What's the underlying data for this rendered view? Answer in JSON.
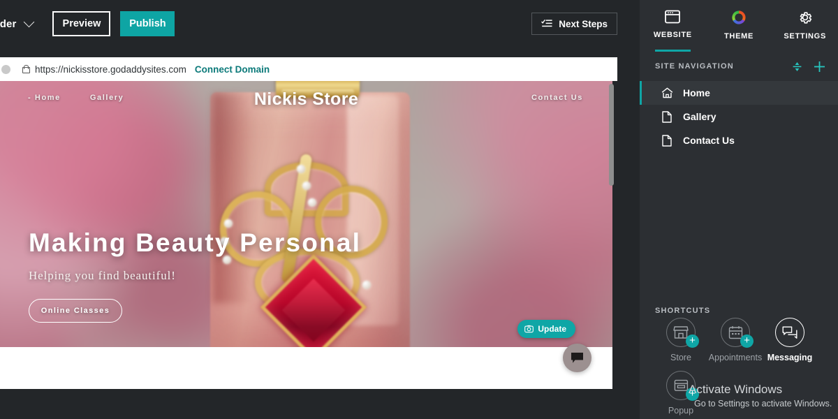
{
  "toolbar": {
    "brand_label": "uilder",
    "brand_chevron": "chevron-down-icon",
    "preview_label": "Preview",
    "publish_label": "Publish",
    "next_steps_label": "Next Steps",
    "next_steps_icon": "checklist-icon"
  },
  "browser": {
    "url": "https://nickisstore.godaddysites.com",
    "connect_domain_label": "Connect Domain",
    "lock_icon": "lock-icon"
  },
  "site": {
    "title": "Nickis Store",
    "nav": [
      {
        "label": "- Home"
      },
      {
        "label": "Gallery"
      },
      {
        "label": "Contact Us"
      }
    ],
    "hero_title": "Making Beauty Personal",
    "hero_subtitle": "Helping you find beautiful!",
    "hero_button": "Online Classes",
    "update_button": "Update",
    "update_icon": "image-icon",
    "chat_icon": "chat-bubble-icon"
  },
  "panel": {
    "tabs": [
      {
        "label": "WEBSITE",
        "icon": "browser-window-icon",
        "active": true
      },
      {
        "label": "THEME",
        "icon": "color-wheel-icon",
        "active": false
      },
      {
        "label": "SETTINGS",
        "icon": "gear-icon",
        "active": false
      }
    ],
    "site_navigation": {
      "title": "SITE NAVIGATION",
      "reorder_icon": "reorder-icon",
      "add_icon": "plus-icon",
      "items": [
        {
          "label": "Home",
          "icon": "home-icon",
          "active": true
        },
        {
          "label": "Gallery",
          "icon": "page-icon",
          "active": false
        },
        {
          "label": "Contact Us",
          "icon": "page-icon",
          "active": false
        }
      ]
    },
    "shortcuts": {
      "title": "SHORTCUTS",
      "items": [
        {
          "label": "Store",
          "icon": "store-icon",
          "badge": "+",
          "active": false
        },
        {
          "label": "Appointments",
          "icon": "calendar-icon",
          "badge": "+",
          "active": false
        },
        {
          "label": "Messaging",
          "icon": "messaging-icon",
          "badge": "",
          "active": true
        },
        {
          "label": "Popup",
          "icon": "popup-icon",
          "badge": "+",
          "active": false
        }
      ]
    }
  },
  "watermark": {
    "title": "Activate Windows",
    "subtitle": "Go to Settings to activate Windows."
  },
  "colors": {
    "accent_teal": "#0fa6a6",
    "panel_bg": "#2c2f33",
    "toolbar_bg": "#232629",
    "link_teal": "#0c7a7a"
  }
}
